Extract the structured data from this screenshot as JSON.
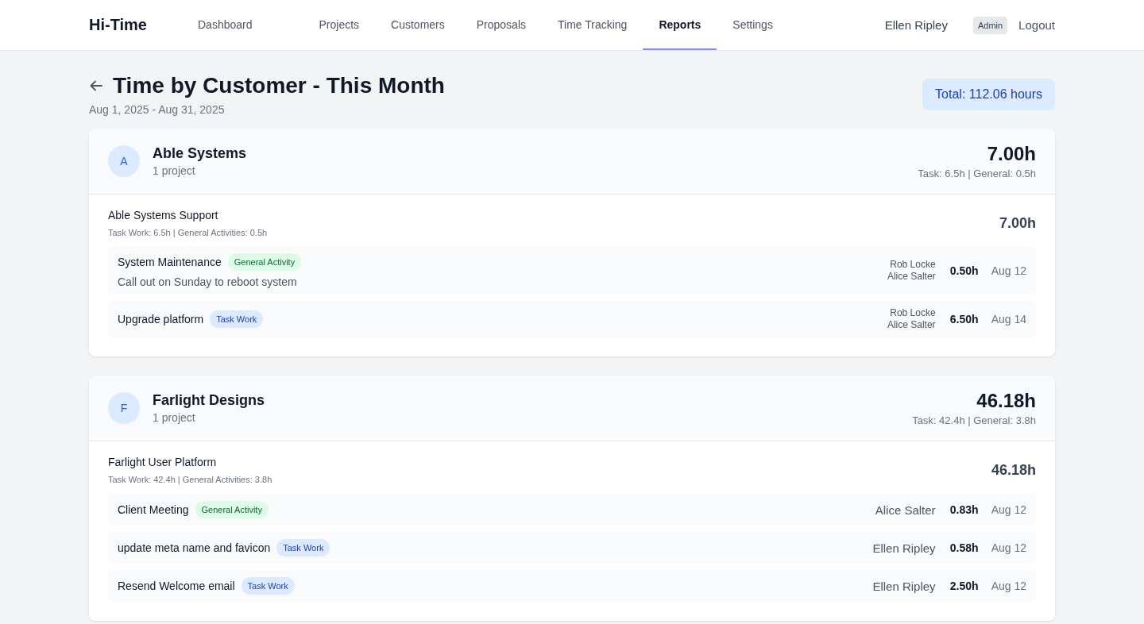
{
  "brand": "Hi-Time",
  "nav": [
    {
      "label": "Dashboard",
      "selected": false
    },
    {
      "label": "Projects",
      "selected": false
    },
    {
      "label": "Customers",
      "selected": false
    },
    {
      "label": "Proposals",
      "selected": false
    },
    {
      "label": "Time Tracking",
      "selected": false
    },
    {
      "label": "Reports",
      "selected": true
    },
    {
      "label": "Settings",
      "selected": false
    }
  ],
  "user": {
    "name": "Ellen Ripley",
    "role": "Admin",
    "logout": "Logout"
  },
  "page": {
    "title": "Time by Customer - This Month",
    "date_range": "Aug 1, 2025 - Aug 31, 2025",
    "total": "Total: 112.06 hours"
  },
  "customers": [
    {
      "initial": "A",
      "name": "Able Systems",
      "projects_count": "1 project",
      "hours": "7.00h",
      "breakdown": "Task: 6.5h | General: 0.5h",
      "projects": [
        {
          "name": "Able Systems Support",
          "breakdown": "Task Work: 6.5h | General Activities: 0.5h",
          "hours": "7.00h",
          "entries": [
            {
              "title": "System Maintenance",
              "tag": "General Activity",
              "kind": "general",
              "note": "Call out on Sunday to reboot system",
              "people": [
                "Rob Locke",
                "Alice Salter"
              ],
              "hours": "0.50h",
              "date": "Aug 12"
            },
            {
              "title": "Upgrade platform",
              "tag": "Task Work",
              "kind": "task",
              "people": [
                "Rob Locke",
                "Alice Salter"
              ],
              "hours": "6.50h",
              "date": "Aug 14"
            }
          ]
        }
      ]
    },
    {
      "initial": "F",
      "name": "Farlight Designs",
      "projects_count": "1 project",
      "hours": "46.18h",
      "breakdown": "Task: 42.4h | General: 3.8h",
      "projects": [
        {
          "name": "Farlight User Platform",
          "breakdown": "Task Work: 42.4h | General Activities: 3.8h",
          "hours": "46.18h",
          "entries": [
            {
              "title": "Client Meeting",
              "tag": "General Activity",
              "kind": "general",
              "people": [
                "Alice Salter"
              ],
              "hours": "0.83h",
              "date": "Aug 12"
            },
            {
              "title": "update meta name and favicon",
              "tag": "Task Work",
              "kind": "task",
              "people": [
                "Ellen Ripley"
              ],
              "hours": "0.58h",
              "date": "Aug 12"
            },
            {
              "title": "Resend Welcome email",
              "tag": "Task Work",
              "kind": "task",
              "people": [
                "Ellen Ripley"
              ],
              "hours": "2.50h",
              "date": "Aug 12"
            }
          ]
        }
      ]
    }
  ]
}
